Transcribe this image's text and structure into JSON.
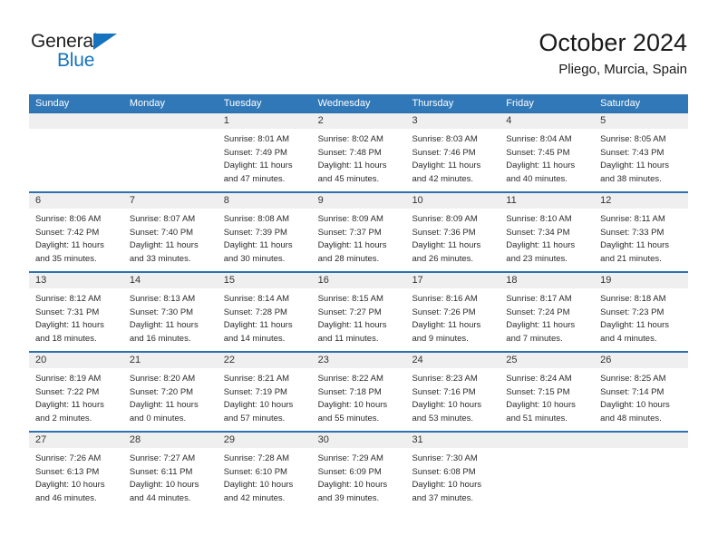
{
  "brand": {
    "name_top": "General",
    "name_bottom": "Blue",
    "triangle_color": "#1573c0",
    "text_color": "#222222"
  },
  "header": {
    "title": "October 2024",
    "subtitle": "Pliego, Murcia, Spain"
  },
  "colors": {
    "header_blue": "#3178b8",
    "row_divider_blue": "#2e71b0",
    "day_band_gray": "#efefef",
    "text": "#2b2b2b"
  },
  "weekday_headers": [
    "Sunday",
    "Monday",
    "Tuesday",
    "Wednesday",
    "Thursday",
    "Friday",
    "Saturday"
  ],
  "labels": {
    "sunrise": "Sunrise:",
    "sunset": "Sunset:",
    "daylight": "Daylight:"
  },
  "weeks": [
    [
      {
        "day": "",
        "sunrise": "",
        "sunset": "",
        "daylight_line1": "",
        "daylight_line2": ""
      },
      {
        "day": "",
        "sunrise": "",
        "sunset": "",
        "daylight_line1": "",
        "daylight_line2": ""
      },
      {
        "day": "1",
        "sunrise": "Sunrise: 8:01 AM",
        "sunset": "Sunset: 7:49 PM",
        "daylight_line1": "Daylight: 11 hours",
        "daylight_line2": "and 47 minutes."
      },
      {
        "day": "2",
        "sunrise": "Sunrise: 8:02 AM",
        "sunset": "Sunset: 7:48 PM",
        "daylight_line1": "Daylight: 11 hours",
        "daylight_line2": "and 45 minutes."
      },
      {
        "day": "3",
        "sunrise": "Sunrise: 8:03 AM",
        "sunset": "Sunset: 7:46 PM",
        "daylight_line1": "Daylight: 11 hours",
        "daylight_line2": "and 42 minutes."
      },
      {
        "day": "4",
        "sunrise": "Sunrise: 8:04 AM",
        "sunset": "Sunset: 7:45 PM",
        "daylight_line1": "Daylight: 11 hours",
        "daylight_line2": "and 40 minutes."
      },
      {
        "day": "5",
        "sunrise": "Sunrise: 8:05 AM",
        "sunset": "Sunset: 7:43 PM",
        "daylight_line1": "Daylight: 11 hours",
        "daylight_line2": "and 38 minutes."
      }
    ],
    [
      {
        "day": "6",
        "sunrise": "Sunrise: 8:06 AM",
        "sunset": "Sunset: 7:42 PM",
        "daylight_line1": "Daylight: 11 hours",
        "daylight_line2": "and 35 minutes."
      },
      {
        "day": "7",
        "sunrise": "Sunrise: 8:07 AM",
        "sunset": "Sunset: 7:40 PM",
        "daylight_line1": "Daylight: 11 hours",
        "daylight_line2": "and 33 minutes."
      },
      {
        "day": "8",
        "sunrise": "Sunrise: 8:08 AM",
        "sunset": "Sunset: 7:39 PM",
        "daylight_line1": "Daylight: 11 hours",
        "daylight_line2": "and 30 minutes."
      },
      {
        "day": "9",
        "sunrise": "Sunrise: 8:09 AM",
        "sunset": "Sunset: 7:37 PM",
        "daylight_line1": "Daylight: 11 hours",
        "daylight_line2": "and 28 minutes."
      },
      {
        "day": "10",
        "sunrise": "Sunrise: 8:09 AM",
        "sunset": "Sunset: 7:36 PM",
        "daylight_line1": "Daylight: 11 hours",
        "daylight_line2": "and 26 minutes."
      },
      {
        "day": "11",
        "sunrise": "Sunrise: 8:10 AM",
        "sunset": "Sunset: 7:34 PM",
        "daylight_line1": "Daylight: 11 hours",
        "daylight_line2": "and 23 minutes."
      },
      {
        "day": "12",
        "sunrise": "Sunrise: 8:11 AM",
        "sunset": "Sunset: 7:33 PM",
        "daylight_line1": "Daylight: 11 hours",
        "daylight_line2": "and 21 minutes."
      }
    ],
    [
      {
        "day": "13",
        "sunrise": "Sunrise: 8:12 AM",
        "sunset": "Sunset: 7:31 PM",
        "daylight_line1": "Daylight: 11 hours",
        "daylight_line2": "and 18 minutes."
      },
      {
        "day": "14",
        "sunrise": "Sunrise: 8:13 AM",
        "sunset": "Sunset: 7:30 PM",
        "daylight_line1": "Daylight: 11 hours",
        "daylight_line2": "and 16 minutes."
      },
      {
        "day": "15",
        "sunrise": "Sunrise: 8:14 AM",
        "sunset": "Sunset: 7:28 PM",
        "daylight_line1": "Daylight: 11 hours",
        "daylight_line2": "and 14 minutes."
      },
      {
        "day": "16",
        "sunrise": "Sunrise: 8:15 AM",
        "sunset": "Sunset: 7:27 PM",
        "daylight_line1": "Daylight: 11 hours",
        "daylight_line2": "and 11 minutes."
      },
      {
        "day": "17",
        "sunrise": "Sunrise: 8:16 AM",
        "sunset": "Sunset: 7:26 PM",
        "daylight_line1": "Daylight: 11 hours",
        "daylight_line2": "and 9 minutes."
      },
      {
        "day": "18",
        "sunrise": "Sunrise: 8:17 AM",
        "sunset": "Sunset: 7:24 PM",
        "daylight_line1": "Daylight: 11 hours",
        "daylight_line2": "and 7 minutes."
      },
      {
        "day": "19",
        "sunrise": "Sunrise: 8:18 AM",
        "sunset": "Sunset: 7:23 PM",
        "daylight_line1": "Daylight: 11 hours",
        "daylight_line2": "and 4 minutes."
      }
    ],
    [
      {
        "day": "20",
        "sunrise": "Sunrise: 8:19 AM",
        "sunset": "Sunset: 7:22 PM",
        "daylight_line1": "Daylight: 11 hours",
        "daylight_line2": "and 2 minutes."
      },
      {
        "day": "21",
        "sunrise": "Sunrise: 8:20 AM",
        "sunset": "Sunset: 7:20 PM",
        "daylight_line1": "Daylight: 11 hours",
        "daylight_line2": "and 0 minutes."
      },
      {
        "day": "22",
        "sunrise": "Sunrise: 8:21 AM",
        "sunset": "Sunset: 7:19 PM",
        "daylight_line1": "Daylight: 10 hours",
        "daylight_line2": "and 57 minutes."
      },
      {
        "day": "23",
        "sunrise": "Sunrise: 8:22 AM",
        "sunset": "Sunset: 7:18 PM",
        "daylight_line1": "Daylight: 10 hours",
        "daylight_line2": "and 55 minutes."
      },
      {
        "day": "24",
        "sunrise": "Sunrise: 8:23 AM",
        "sunset": "Sunset: 7:16 PM",
        "daylight_line1": "Daylight: 10 hours",
        "daylight_line2": "and 53 minutes."
      },
      {
        "day": "25",
        "sunrise": "Sunrise: 8:24 AM",
        "sunset": "Sunset: 7:15 PM",
        "daylight_line1": "Daylight: 10 hours",
        "daylight_line2": "and 51 minutes."
      },
      {
        "day": "26",
        "sunrise": "Sunrise: 8:25 AM",
        "sunset": "Sunset: 7:14 PM",
        "daylight_line1": "Daylight: 10 hours",
        "daylight_line2": "and 48 minutes."
      }
    ],
    [
      {
        "day": "27",
        "sunrise": "Sunrise: 7:26 AM",
        "sunset": "Sunset: 6:13 PM",
        "daylight_line1": "Daylight: 10 hours",
        "daylight_line2": "and 46 minutes."
      },
      {
        "day": "28",
        "sunrise": "Sunrise: 7:27 AM",
        "sunset": "Sunset: 6:11 PM",
        "daylight_line1": "Daylight: 10 hours",
        "daylight_line2": "and 44 minutes."
      },
      {
        "day": "29",
        "sunrise": "Sunrise: 7:28 AM",
        "sunset": "Sunset: 6:10 PM",
        "daylight_line1": "Daylight: 10 hours",
        "daylight_line2": "and 42 minutes."
      },
      {
        "day": "30",
        "sunrise": "Sunrise: 7:29 AM",
        "sunset": "Sunset: 6:09 PM",
        "daylight_line1": "Daylight: 10 hours",
        "daylight_line2": "and 39 minutes."
      },
      {
        "day": "31",
        "sunrise": "Sunrise: 7:30 AM",
        "sunset": "Sunset: 6:08 PM",
        "daylight_line1": "Daylight: 10 hours",
        "daylight_line2": "and 37 minutes."
      },
      {
        "day": "",
        "sunrise": "",
        "sunset": "",
        "daylight_line1": "",
        "daylight_line2": ""
      },
      {
        "day": "",
        "sunrise": "",
        "sunset": "",
        "daylight_line1": "",
        "daylight_line2": ""
      }
    ]
  ]
}
